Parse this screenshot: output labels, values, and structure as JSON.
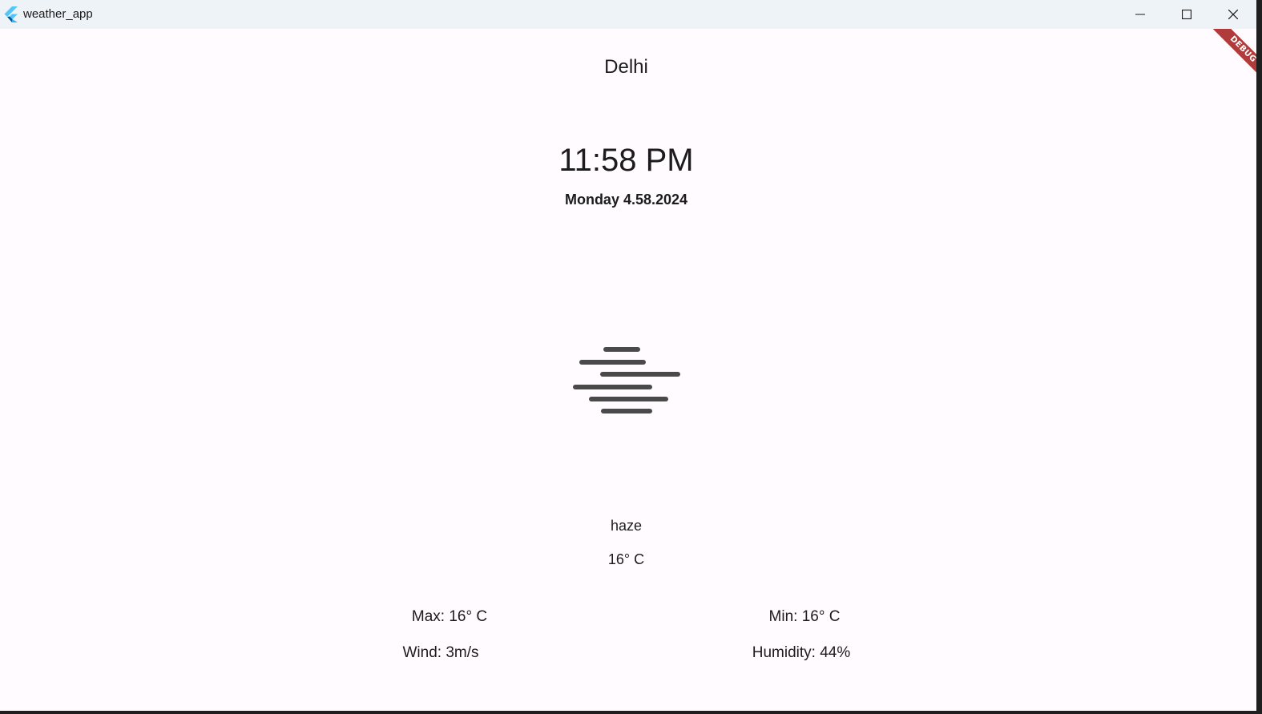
{
  "window": {
    "title": "weather_app",
    "controls": {
      "minimize_icon": "minimize-icon",
      "maximize_icon": "maximize-icon",
      "close_icon": "close-icon"
    },
    "debug_banner": "DEBUG"
  },
  "weather": {
    "city": "Delhi",
    "time": "11:58 PM",
    "date": "Monday 4.58.2024",
    "icon": "haze-icon",
    "condition": "haze",
    "temperature": "16° C",
    "details": {
      "max": "Max: 16° C",
      "min": "Min: 16° C",
      "wind": "Wind: 3m/s",
      "humidity": "Humidity: 44%"
    }
  },
  "colors": {
    "background": "#fffbfe",
    "titlebar": "#eef3f8",
    "text": "#1c1b1f",
    "icon": "#4a4a4a",
    "debug_banner": "#b13a3a",
    "flutter_blue_light": "#54c5f8",
    "flutter_blue_dark": "#01579b"
  }
}
